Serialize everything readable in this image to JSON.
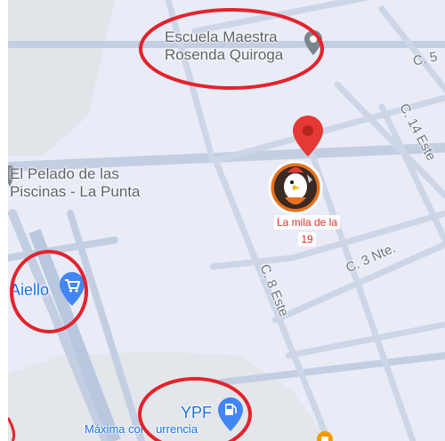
{
  "map": {
    "pois": {
      "school": {
        "line1": "Escuela Maestra",
        "line2": "Rosenda Quiroga",
        "icon": "location-pin-icon"
      },
      "pool": {
        "line1": "El Pelado de las",
        "line2": "Piscinas - La Punta",
        "icon": "location-pin-icon"
      },
      "shop": {
        "name": "Aiello",
        "icon": "shopping-cart-icon"
      },
      "fuel": {
        "name": "YPF",
        "icon": "gas-station-icon"
      },
      "competition": {
        "text_before": "Máxima con",
        "text_after": "urrencia"
      }
    },
    "selected_place": {
      "line1": "La mila de la",
      "line2": "19",
      "icon": "chicken-chef-avatar-icon",
      "marker": "red-map-pin-icon"
    },
    "streets": {
      "c5": "C. 5",
      "c14_este": "C. 14 Este",
      "c8_este": "C. 8 Este",
      "c3_nte": "C. 3 Nte."
    }
  },
  "annotations": {
    "circles": 4,
    "color": "#e4232c"
  },
  "colors": {
    "map_bg": "#e9ecf6",
    "road": "#c6d0e3",
    "park": "#e3e6ea",
    "pin_red": "#e53935",
    "poi_blue": "#4285f4",
    "marker_orange": "#e8711f"
  }
}
